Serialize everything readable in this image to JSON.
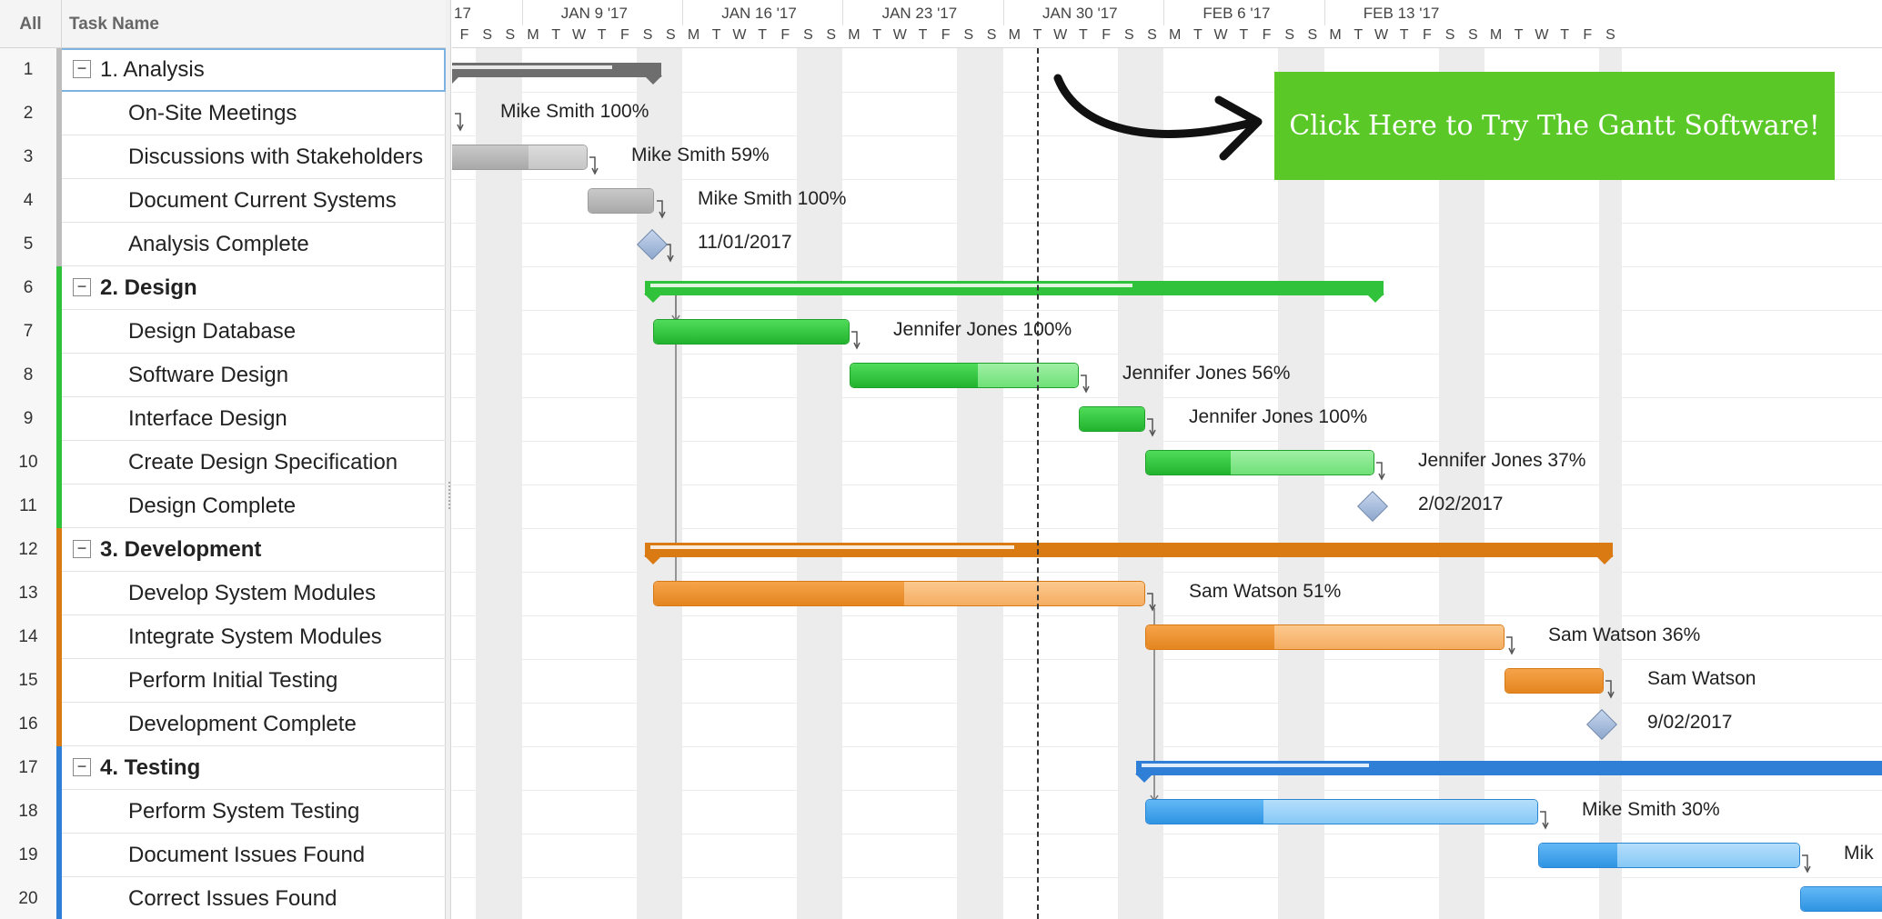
{
  "grid": {
    "header_all": "All",
    "header_task_name": "Task Name",
    "rows": [
      {
        "num": "1",
        "name": "1. Analysis"
      },
      {
        "num": "2",
        "name": "On-Site Meetings"
      },
      {
        "num": "3",
        "name": "Discussions with Stakeholders"
      },
      {
        "num": "4",
        "name": "Document Current Systems"
      },
      {
        "num": "5",
        "name": "Analysis Complete"
      },
      {
        "num": "6",
        "name": "2. Design"
      },
      {
        "num": "7",
        "name": "Design Database"
      },
      {
        "num": "8",
        "name": "Software Design"
      },
      {
        "num": "9",
        "name": "Interface Design"
      },
      {
        "num": "10",
        "name": "Create Design Specification"
      },
      {
        "num": "11",
        "name": "Design Complete"
      },
      {
        "num": "12",
        "name": "3. Development"
      },
      {
        "num": "13",
        "name": "Develop System Modules"
      },
      {
        "num": "14",
        "name": "Integrate System Modules"
      },
      {
        "num": "15",
        "name": "Perform Initial Testing"
      },
      {
        "num": "16",
        "name": "Development Complete"
      },
      {
        "num": "17",
        "name": "4. Testing"
      },
      {
        "num": "18",
        "name": "Perform System Testing"
      },
      {
        "num": "19",
        "name": "Document Issues Found"
      },
      {
        "num": "20",
        "name": "Correct Issues Found"
      }
    ],
    "toggle_glyph": "−"
  },
  "timescale": {
    "weeks": [
      "17",
      "JAN 9 '17",
      "JAN 16 '17",
      "JAN 23 '17",
      "JAN 30 '17",
      "FEB 6 '17",
      "FEB 13 '17"
    ],
    "days": [
      "F",
      "S",
      "S",
      "M",
      "T",
      "W",
      "T",
      "F",
      "S",
      "S",
      "M",
      "T",
      "W",
      "T",
      "F",
      "S",
      "S",
      "M",
      "T",
      "W",
      "T",
      "F",
      "S",
      "S",
      "M",
      "T",
      "W",
      "T",
      "F",
      "S",
      "S",
      "M",
      "T",
      "W",
      "T",
      "F",
      "S",
      "S",
      "M",
      "T",
      "W",
      "T",
      "F",
      "S",
      "S",
      "M",
      "T",
      "W",
      "T",
      "F",
      "S"
    ]
  },
  "chart": {
    "labels": {
      "r2": "Mike Smith  100%",
      "r3": "Mike Smith  59%",
      "r4": "Mike Smith  100%",
      "r5": "11/01/2017",
      "r7": "Jennifer Jones  100%",
      "r8": "Jennifer Jones  56%",
      "r9": "Jennifer Jones  100%",
      "r10": "Jennifer Jones  37%",
      "r11": "2/02/2017",
      "r13": "Sam Watson  51%",
      "r14": "Sam Watson  36%",
      "r15": "Sam Watson",
      "r16": "9/02/2017",
      "r18": "Mike Smith  30%",
      "r19": "Mik"
    },
    "progress": {
      "r3": 0.59,
      "r8": 0.56,
      "r10": 0.37,
      "r13": 0.51,
      "r14": 0.36,
      "r18": 0.3
    },
    "colors": {
      "analysis": "#6e6e6e",
      "design": "#2fc23a",
      "development": "#d97a12",
      "testing": "#2f7fd6",
      "cta_bg": "#5ac827"
    }
  },
  "cta": {
    "label": "Click Here to Try The Gantt Software!"
  }
}
